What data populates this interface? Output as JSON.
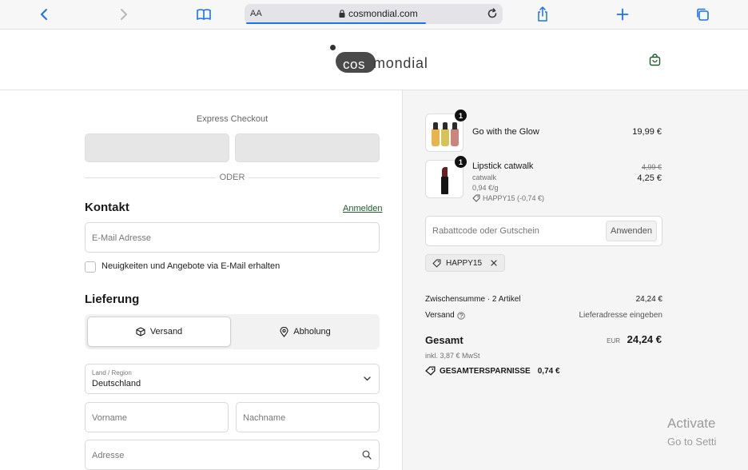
{
  "browser": {
    "text_size_label": "AA",
    "url": "cosmondial.com"
  },
  "header": {
    "logo_prefix": "cos",
    "logo_suffix": "mondial"
  },
  "checkout": {
    "express_label": "Express Checkout",
    "or_label": "ODER",
    "contact_title": "Kontakt",
    "login_label": "Anmelden",
    "email_placeholder": "E-Mail Adresse",
    "newsletter_label": "Neuigkeiten und Angebote via E-Mail erhalten",
    "delivery_title": "Lieferung",
    "ship_option": "Versand",
    "pickup_option": "Abholung",
    "country_label": "Land / Region",
    "country_value": "Deutschland",
    "first_name_placeholder": "Vorname",
    "last_name_placeholder": "Nachname",
    "address_placeholder": "Adresse"
  },
  "cart": {
    "items": [
      {
        "qty": "1",
        "name": "Go with the Glow",
        "price": "19,99 €"
      },
      {
        "qty": "1",
        "name": "Lipstick catwalk",
        "variant": "catwalk",
        "unit_price": "0,94 €/g",
        "discount": "HAPPY15 (-0,74 €)",
        "old_price": "4,99 €",
        "price": "4,25 €"
      }
    ],
    "discount_placeholder": "Rabattcode oder Gutschein",
    "apply_label": "Anwenden",
    "applied_code": "HAPPY15",
    "subtotal_label": "Zwischensumme · 2 Artikel",
    "subtotal_value": "24,24 €",
    "shipping_label": "Versand",
    "shipping_value": "Lieferadresse eingeben",
    "total_label": "Gesamt",
    "currency": "EUR",
    "total_value": "24,24 €",
    "tax_note": "inkl. 3,87 € MwSt",
    "savings_label": "GESAMTERSPARNISSE",
    "savings_value": "0,74 €"
  },
  "os_overlay": {
    "line1": "Activate",
    "line2": "Go to Setti"
  },
  "colors": {
    "accent_link": "#1f5a2e",
    "browser_blue": "#1a73e8",
    "summary_bg": "#f5f5f5"
  }
}
